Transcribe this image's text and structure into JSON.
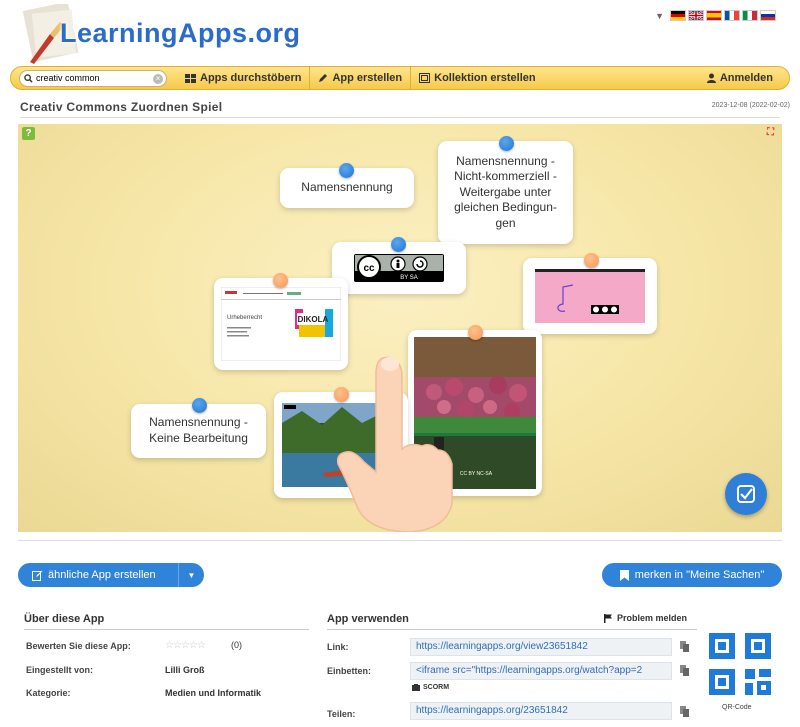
{
  "header": {
    "logo_text": "LearningApps.org"
  },
  "navbar": {
    "search_value": "creativ common",
    "browse_label": "Apps durchstöbern",
    "create_label": "App erstellen",
    "collection_label": "Kollektion erstellen",
    "login_label": "Anmelden"
  },
  "app": {
    "title": "Creativ Commons Zuordnen Spiel",
    "date": "2023-12-08 (2022-02-02)",
    "cards": {
      "namensnennung": "Namensnennung",
      "nc_sa": "Namensnennung - Nicht-kommerziell - Weitergabe unter gleichen Bedingun-gen",
      "nd": "Namensnennung - Keine Bearbeitung"
    },
    "cc_by_sa_label": "BY   SA",
    "cc_by_nc_sa_caption": "CC BY NC-SA",
    "dikola_label": "DIKOLA",
    "slide_title": "Urheberrecht"
  },
  "actions": {
    "similar_label": "ähnliche App erstellen",
    "merken_label": "merken in \"Meine Sachen\""
  },
  "about": {
    "heading": "Über diese App",
    "rate_label": "Bewerten Sie diese App:",
    "rating_stars": "☆☆☆☆☆",
    "rating_count": "(0)",
    "author_label": "Eingestellt von:",
    "author_value": "Lilli Groß",
    "category_label": "Kategorie:",
    "category_value": "Medien und Informatik"
  },
  "use": {
    "heading": "App verwenden",
    "problem_label": "Problem melden",
    "link_label": "Link:",
    "link_value": "https://learningapps.org/view23651842",
    "embed_label": "Einbetten:",
    "embed_value": "<iframe src=\"https://learningapps.org/watch?app=2",
    "scorm_label": "SCORM",
    "share_label": "Teilen:",
    "share_value": "https://learningapps.org/23651842",
    "qr_label": "QR-Code"
  },
  "colors": {
    "accent_blue": "#2f83d8",
    "navbar_yellow": "#f6c94a",
    "pin_blue": "#2176d4",
    "pin_orange": "#f5975a"
  }
}
